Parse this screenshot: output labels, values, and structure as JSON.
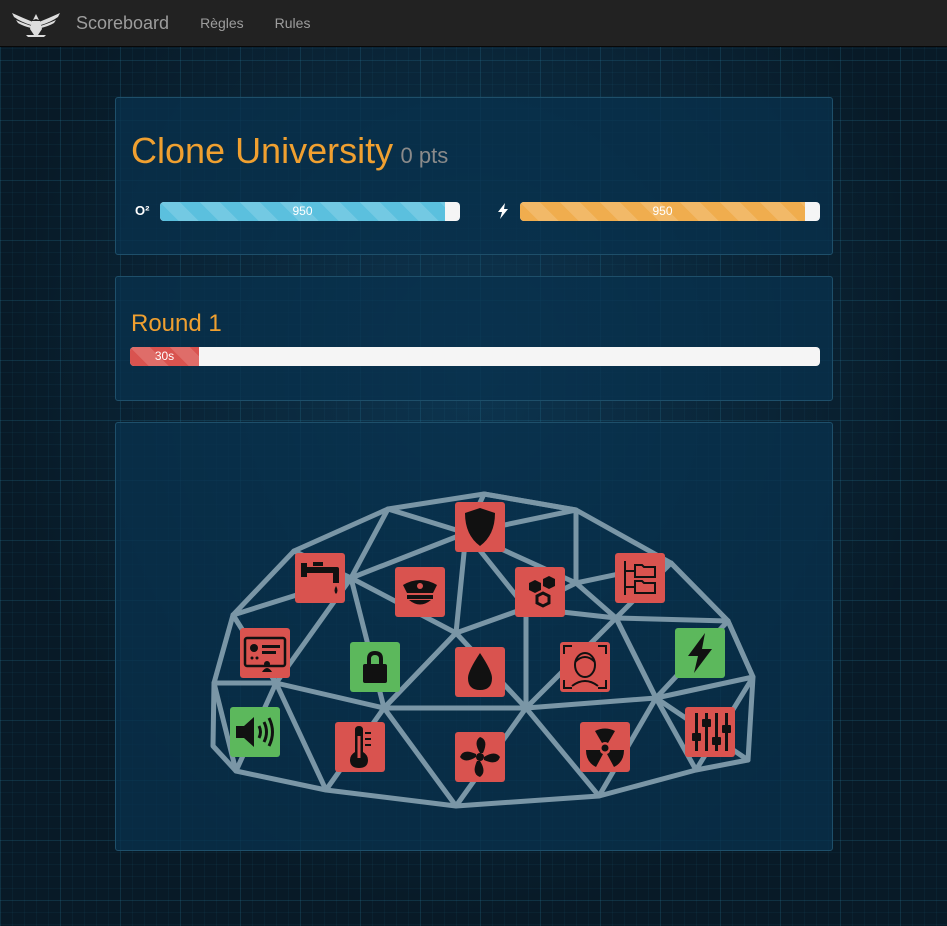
{
  "nav": {
    "brand": "Scoreboard",
    "links": [
      "Règles",
      "Rules"
    ]
  },
  "team": {
    "name": "Clone University",
    "points": "0 pts",
    "oxygen": {
      "label": "O²",
      "value": "950",
      "fraction": 0.95,
      "color": "#5bc0de"
    },
    "power": {
      "icon": "bolt-icon",
      "value": "950",
      "fraction": 0.95,
      "color": "#f0ad4e"
    }
  },
  "round": {
    "title": "Round 1",
    "timer": "30s",
    "fraction": 0.1
  },
  "dome": {
    "modules": [
      {
        "icon": "shield-icon",
        "status": "red"
      },
      {
        "icon": "faucet-icon",
        "status": "red"
      },
      {
        "icon": "police-cap-icon",
        "status": "red"
      },
      {
        "icon": "hexagons-icon",
        "status": "red"
      },
      {
        "icon": "folder-tree-icon",
        "status": "red"
      },
      {
        "icon": "id-card-icon",
        "status": "red"
      },
      {
        "icon": "lock-icon",
        "status": "green"
      },
      {
        "icon": "water-drop-icon",
        "status": "red"
      },
      {
        "icon": "face-scan-icon",
        "status": "red"
      },
      {
        "icon": "bolt-icon",
        "status": "green"
      },
      {
        "icon": "speaker-icon",
        "status": "green"
      },
      {
        "icon": "thermometer-icon",
        "status": "red"
      },
      {
        "icon": "fan-icon",
        "status": "red"
      },
      {
        "icon": "radiation-icon",
        "status": "red"
      },
      {
        "icon": "sliders-icon",
        "status": "red"
      }
    ],
    "status_colors": {
      "red": "#d9534f",
      "green": "#5cb85c"
    }
  }
}
